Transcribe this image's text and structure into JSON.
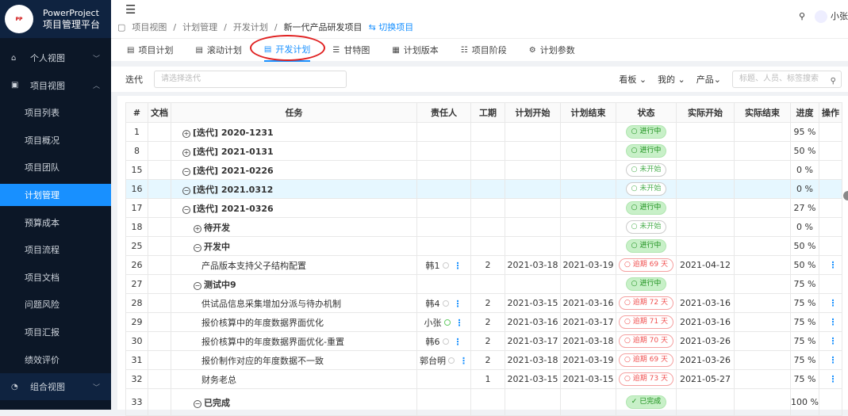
{
  "brand": {
    "logo_text": "PowerProject",
    "name": "PowerProject",
    "subtitle": "项目管理平台"
  },
  "sidebar": {
    "items": [
      {
        "label": "个人视图",
        "type": "group",
        "icon": "home-icon"
      },
      {
        "label": "项目视图",
        "type": "group",
        "icon": "grid-icon",
        "expanded": true
      },
      {
        "label": "项目列表",
        "type": "sub"
      },
      {
        "label": "项目概况",
        "type": "sub"
      },
      {
        "label": "项目团队",
        "type": "sub"
      },
      {
        "label": "计划管理",
        "type": "sub",
        "active": true
      },
      {
        "label": "预算成本",
        "type": "sub"
      },
      {
        "label": "项目流程",
        "type": "sub"
      },
      {
        "label": "项目文档",
        "type": "sub"
      },
      {
        "label": "问题风险",
        "type": "sub"
      },
      {
        "label": "项目汇报",
        "type": "sub"
      },
      {
        "label": "绩效评价",
        "type": "sub"
      },
      {
        "label": "组合视图",
        "type": "group",
        "icon": "dashboard-icon"
      }
    ]
  },
  "breadcrumb": {
    "items": [
      "项目视图",
      "计划管理",
      "开发计划"
    ],
    "current": "新一代产品研发项目",
    "switch": "切换项目"
  },
  "user": {
    "name": "小张"
  },
  "tabs": [
    {
      "label": "项目计划"
    },
    {
      "label": "滚动计划"
    },
    {
      "label": "开发计划",
      "active": true
    },
    {
      "label": "甘特图"
    },
    {
      "label": "计划版本"
    },
    {
      "label": "项目阶段"
    },
    {
      "label": "计划参数"
    }
  ],
  "filter": {
    "label": "迭代",
    "placeholder": "请选择迭代",
    "kanban": "看板",
    "mine": "我的",
    "product": "产品",
    "search_placeholder": "标题、人员、标签搜索"
  },
  "table": {
    "headers": [
      "#",
      "文档",
      "任务",
      "责任人",
      "工期",
      "计划开始",
      "计划结束",
      "状态",
      "实际开始",
      "实际结束",
      "进度",
      "操作"
    ],
    "rows": [
      {
        "no": "1",
        "task": "[迭代] 2020-1231",
        "toggle": "+",
        "level": 0,
        "owner": "",
        "dur": "",
        "ps": "",
        "pe": "",
        "status": "进行中",
        "st": "green",
        "as": "",
        "ae": "",
        "prog": "95 %"
      },
      {
        "no": "8",
        "task": "[迭代] 2021-0131",
        "toggle": "+",
        "level": 0,
        "owner": "",
        "dur": "",
        "ps": "",
        "pe": "",
        "status": "进行中",
        "st": "green",
        "as": "",
        "ae": "",
        "prog": "50 %"
      },
      {
        "no": "15",
        "task": "[迭代] 2021-0226",
        "toggle": "-",
        "level": 0,
        "owner": "",
        "dur": "",
        "ps": "",
        "pe": "",
        "status": "未开始",
        "st": "gray",
        "as": "",
        "ae": "",
        "prog": "0 %"
      },
      {
        "no": "16",
        "task": "[迭代] 2021.0312",
        "toggle": "-",
        "level": 0,
        "owner": "",
        "dur": "",
        "ps": "",
        "pe": "",
        "status": "未开始",
        "st": "gray",
        "as": "",
        "ae": "",
        "prog": "0 %",
        "highlight": true
      },
      {
        "no": "17",
        "task": "[迭代] 2021-0326",
        "toggle": "-",
        "level": 0,
        "owner": "",
        "dur": "",
        "ps": "",
        "pe": "",
        "status": "进行中",
        "st": "green",
        "as": "",
        "ae": "",
        "prog": "27 %"
      },
      {
        "no": "18",
        "task": "待开发",
        "toggle": "+",
        "level": 1,
        "owner": "",
        "dur": "",
        "ps": "",
        "pe": "",
        "status": "未开始",
        "st": "gray",
        "as": "",
        "ae": "",
        "prog": "0 %"
      },
      {
        "no": "25",
        "task": "开发中",
        "toggle": "-",
        "level": 1,
        "owner": "",
        "dur": "",
        "ps": "",
        "pe": "",
        "status": "进行中",
        "st": "green",
        "as": "",
        "ae": "",
        "prog": "50 %"
      },
      {
        "no": "26",
        "task": "产品版本支持父子结构配置",
        "level": 2,
        "owner": "韩1",
        "dur": "2",
        "ps": "2021-03-18",
        "pe": "2021-03-19",
        "status": "逾期 69 天",
        "st": "red",
        "as": "2021-04-12",
        "ae": "",
        "prog": "50 %",
        "op": true
      },
      {
        "no": "27",
        "task": "测试中9",
        "toggle": "-",
        "level": 1,
        "owner": "",
        "dur": "",
        "ps": "",
        "pe": "",
        "status": "进行中",
        "st": "green",
        "as": "",
        "ae": "",
        "prog": "75 %"
      },
      {
        "no": "28",
        "task": "供试品信息采集增加分派与待办机制",
        "level": 2,
        "owner": "韩4",
        "dur": "2",
        "ps": "2021-03-15",
        "pe": "2021-03-16",
        "status": "逾期 72 天",
        "st": "red",
        "as": "2021-03-16",
        "ae": "",
        "prog": "75 %",
        "op": true
      },
      {
        "no": "29",
        "task": "报价核算中的年度数据界面优化",
        "level": 2,
        "owner": "小张",
        "owner_ok": true,
        "dur": "2",
        "ps": "2021-03-16",
        "pe": "2021-03-17",
        "status": "逾期 71 天",
        "st": "red",
        "as": "2021-03-16",
        "ae": "",
        "prog": "75 %",
        "op": true
      },
      {
        "no": "30",
        "task": "报价核算中的年度数据界面优化-重置",
        "level": 2,
        "owner": "韩6",
        "dur": "2",
        "ps": "2021-03-17",
        "pe": "2021-03-18",
        "status": "逾期 70 天",
        "st": "red",
        "as": "2021-03-26",
        "ae": "",
        "prog": "75 %",
        "op": true
      },
      {
        "no": "31",
        "task": "报价制作对应的年度数据不一致",
        "level": 2,
        "owner": "郭台明",
        "dur": "2",
        "ps": "2021-03-18",
        "pe": "2021-03-19",
        "status": "逾期 69 天",
        "st": "red",
        "as": "2021-03-26",
        "ae": "",
        "prog": "75 %",
        "op": true
      },
      {
        "no": "32",
        "task": "财务老总",
        "level": 2,
        "owner": "",
        "dur": "1",
        "ps": "2021-03-15",
        "pe": "2021-03-15",
        "status": "逾期 73 天",
        "st": "red",
        "as": "2021-05-27",
        "ae": "",
        "prog": "75 %",
        "op": true
      },
      {
        "no": "33",
        "task": "已完成",
        "toggle": "-",
        "level": 1,
        "owner": "",
        "dur": "",
        "ps": "",
        "pe": "",
        "status": "已完成",
        "st": "green",
        "as": "",
        "ae": "",
        "prog": "100 %",
        "tall": true
      }
    ]
  }
}
